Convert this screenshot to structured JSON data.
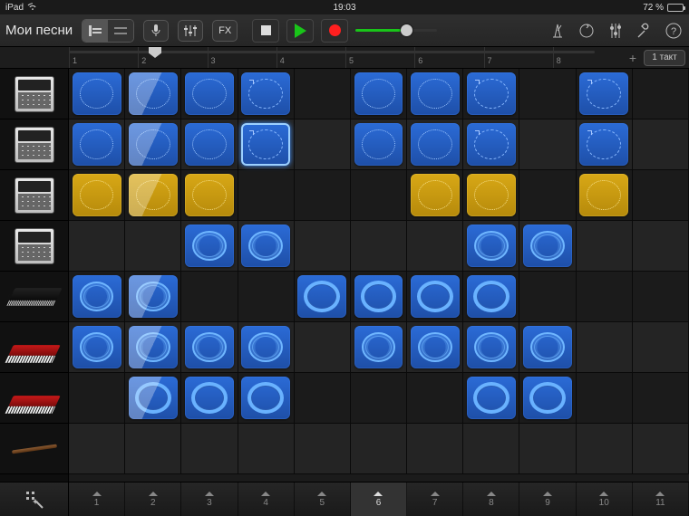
{
  "status": {
    "device": "iPad",
    "time": "19:03",
    "battery_pct": "72 %"
  },
  "toolbar": {
    "title": "Мои песни",
    "fx_label": "FX"
  },
  "ruler": {
    "snap_label": "1 такт",
    "marks": [
      "1",
      "2",
      "3",
      "4",
      "5",
      "6",
      "7",
      "8"
    ]
  },
  "tracks": [
    {
      "kind": "drum"
    },
    {
      "kind": "drum"
    },
    {
      "kind": "drum"
    },
    {
      "kind": "drum"
    },
    {
      "kind": "keys-dark"
    },
    {
      "kind": "keys-red"
    },
    {
      "kind": "keys-red"
    },
    {
      "kind": "flute"
    }
  ],
  "grid": {
    "cols": 11,
    "rows": 8,
    "highlight_col": 2,
    "cells": [
      {
        "r": 0,
        "c": 0,
        "color": "blue",
        "glyph": "dots"
      },
      {
        "r": 0,
        "c": 1,
        "color": "blue",
        "glyph": "dots"
      },
      {
        "r": 0,
        "c": 2,
        "color": "blue",
        "glyph": "dots"
      },
      {
        "r": 0,
        "c": 3,
        "color": "blue",
        "glyph": "arrows"
      },
      {
        "r": 0,
        "c": 5,
        "color": "blue",
        "glyph": "dots"
      },
      {
        "r": 0,
        "c": 6,
        "color": "blue",
        "glyph": "dots"
      },
      {
        "r": 0,
        "c": 7,
        "color": "blue",
        "glyph": "arrows"
      },
      {
        "r": 0,
        "c": 9,
        "color": "blue",
        "glyph": "arrows"
      },
      {
        "r": 1,
        "c": 0,
        "color": "blue",
        "glyph": "dots"
      },
      {
        "r": 1,
        "c": 1,
        "color": "blue",
        "glyph": "dots"
      },
      {
        "r": 1,
        "c": 2,
        "color": "blue",
        "glyph": "dots"
      },
      {
        "r": 1,
        "c": 3,
        "color": "blue",
        "glyph": "arrows",
        "selected": true
      },
      {
        "r": 1,
        "c": 5,
        "color": "blue",
        "glyph": "dots"
      },
      {
        "r": 1,
        "c": 6,
        "color": "blue",
        "glyph": "dots"
      },
      {
        "r": 1,
        "c": 7,
        "color": "blue",
        "glyph": "arrows"
      },
      {
        "r": 1,
        "c": 9,
        "color": "blue",
        "glyph": "arrows"
      },
      {
        "r": 2,
        "c": 0,
        "color": "yellow",
        "glyph": "dots"
      },
      {
        "r": 2,
        "c": 1,
        "color": "yellow",
        "glyph": "dots"
      },
      {
        "r": 2,
        "c": 2,
        "color": "yellow",
        "glyph": "dots"
      },
      {
        "r": 2,
        "c": 6,
        "color": "yellow",
        "glyph": "dots"
      },
      {
        "r": 2,
        "c": 7,
        "color": "yellow",
        "glyph": "dots"
      },
      {
        "r": 2,
        "c": 9,
        "color": "yellow",
        "glyph": "dots"
      },
      {
        "r": 3,
        "c": 2,
        "color": "blue",
        "glyph": "wave"
      },
      {
        "r": 3,
        "c": 3,
        "color": "blue",
        "glyph": "wave"
      },
      {
        "r": 3,
        "c": 7,
        "color": "blue",
        "glyph": "wave"
      },
      {
        "r": 3,
        "c": 8,
        "color": "blue",
        "glyph": "wave"
      },
      {
        "r": 4,
        "c": 0,
        "color": "blue",
        "glyph": "wave"
      },
      {
        "r": 4,
        "c": 1,
        "color": "blue",
        "glyph": "wave"
      },
      {
        "r": 4,
        "c": 4,
        "color": "blue",
        "glyph": "ring"
      },
      {
        "r": 4,
        "c": 5,
        "color": "blue",
        "glyph": "ring"
      },
      {
        "r": 4,
        "c": 6,
        "color": "blue",
        "glyph": "ring"
      },
      {
        "r": 4,
        "c": 7,
        "color": "blue",
        "glyph": "ring"
      },
      {
        "r": 5,
        "c": 0,
        "color": "blue",
        "glyph": "wave"
      },
      {
        "r": 5,
        "c": 1,
        "color": "blue",
        "glyph": "wave"
      },
      {
        "r": 5,
        "c": 2,
        "color": "blue",
        "glyph": "wave"
      },
      {
        "r": 5,
        "c": 3,
        "color": "blue",
        "glyph": "wave"
      },
      {
        "r": 5,
        "c": 5,
        "color": "blue",
        "glyph": "wave"
      },
      {
        "r": 5,
        "c": 6,
        "color": "blue",
        "glyph": "wave"
      },
      {
        "r": 5,
        "c": 7,
        "color": "blue",
        "glyph": "wave"
      },
      {
        "r": 5,
        "c": 8,
        "color": "blue",
        "glyph": "wave"
      },
      {
        "r": 6,
        "c": 1,
        "color": "blue",
        "glyph": "ring"
      },
      {
        "r": 6,
        "c": 2,
        "color": "blue",
        "glyph": "ring"
      },
      {
        "r": 6,
        "c": 3,
        "color": "blue",
        "glyph": "ring"
      },
      {
        "r": 6,
        "c": 7,
        "color": "blue",
        "glyph": "ring"
      },
      {
        "r": 6,
        "c": 8,
        "color": "blue",
        "glyph": "ring"
      }
    ]
  },
  "bottom": {
    "columns": [
      "1",
      "2",
      "3",
      "4",
      "5",
      "6",
      "7",
      "8",
      "9",
      "10",
      "11"
    ],
    "active_col": 6
  }
}
